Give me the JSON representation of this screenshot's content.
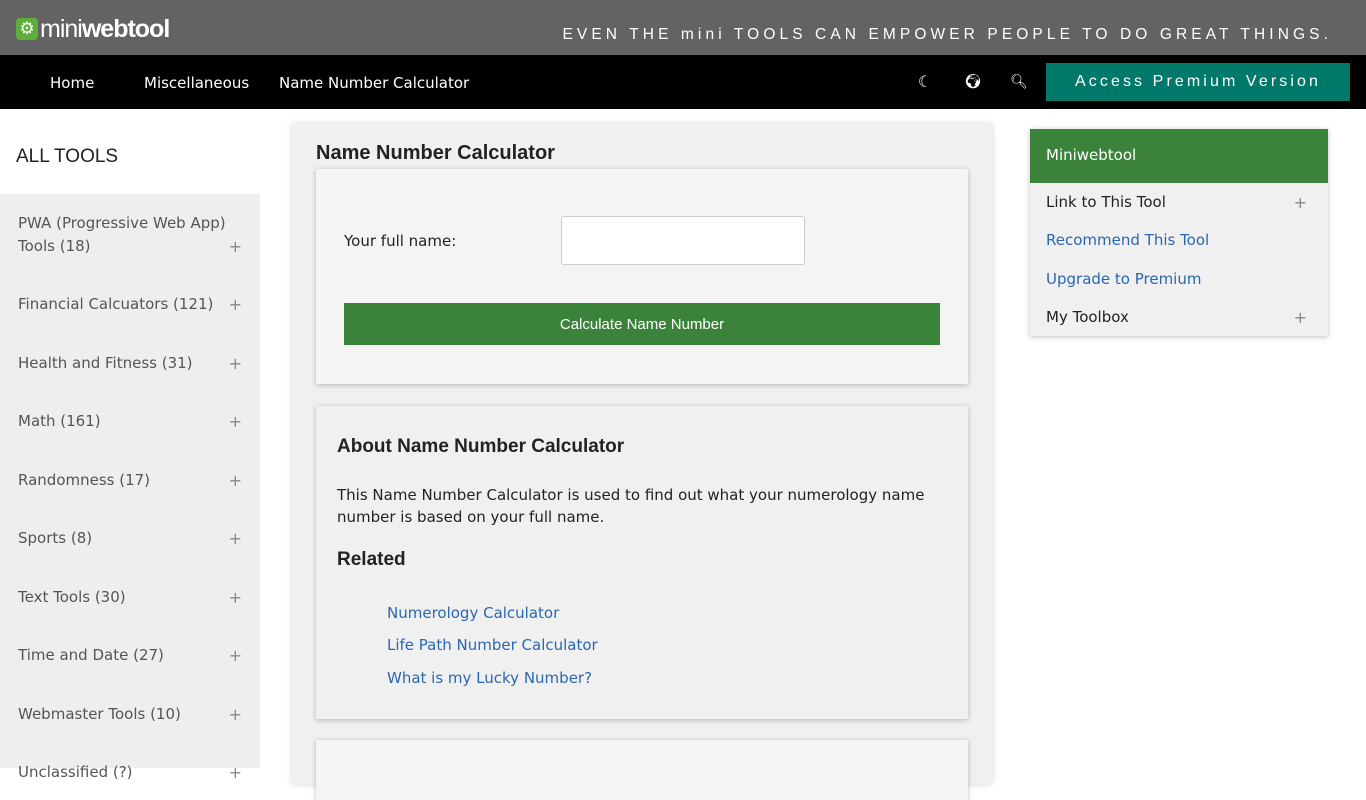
{
  "header": {
    "logo_mini": "mini",
    "logo_web": "webtool",
    "logo_icon": "gear-icon",
    "tagline": "EVEN THE mini TOOLS CAN EMPOWER PEOPLE TO DO GREAT THINGS."
  },
  "nav": {
    "links": [
      "Home",
      "Miscellaneous",
      "Name Number Calculator"
    ],
    "icons": [
      {
        "name": "moon-icon",
        "glyph": "☾"
      },
      {
        "name": "globe-icon",
        "glyph": "🌍︎"
      },
      {
        "name": "search-icon",
        "glyph": "🔍︎"
      }
    ],
    "premium_label": "Access Premium Version",
    "premium_color": "#00796b"
  },
  "sidebar": {
    "title": "ALL TOOLS",
    "items": [
      {
        "label": "PWA (Progressive Web App) Tools (18)",
        "expand": "+"
      },
      {
        "label": "Financial Calcuators (121)",
        "expand": "+"
      },
      {
        "label": "Health and Fitness (31)",
        "expand": "+"
      },
      {
        "label": "Math (161)",
        "expand": "+"
      },
      {
        "label": "Randomness (17)",
        "expand": "+"
      },
      {
        "label": "Sports (8)",
        "expand": "+"
      },
      {
        "label": "Text Tools (30)",
        "expand": "+"
      },
      {
        "label": "Time and Date (27)",
        "expand": "+"
      },
      {
        "label": "Webmaster Tools (10)",
        "expand": "+"
      },
      {
        "label": "Unclassified (?)",
        "expand": "+"
      }
    ]
  },
  "main": {
    "title": "Name Number Calculator",
    "form": {
      "name_label": "Your full name:",
      "name_value": "",
      "name_placeholder": "",
      "submit_label": "Calculate Name Number",
      "submit_color": "#3b833b"
    },
    "about": {
      "title": "About Name Number Calculator",
      "text": "This Name Number Calculator is used to find out what your numerology name number is based on your full name.",
      "related_title": "Related",
      "related_links": [
        "Numerology Calculator",
        "Life Path Number Calculator",
        "What is my Lucky Number?"
      ]
    }
  },
  "right_panel": {
    "title": "Miniwebtool",
    "items": [
      {
        "label": "Link to This Tool",
        "expand": "+"
      },
      {
        "label": "Recommend This Tool"
      },
      {
        "label": "Upgrade to Premium"
      },
      {
        "label": "My Toolbox",
        "expand": "+"
      }
    ],
    "link_color": "#2a67b1"
  }
}
